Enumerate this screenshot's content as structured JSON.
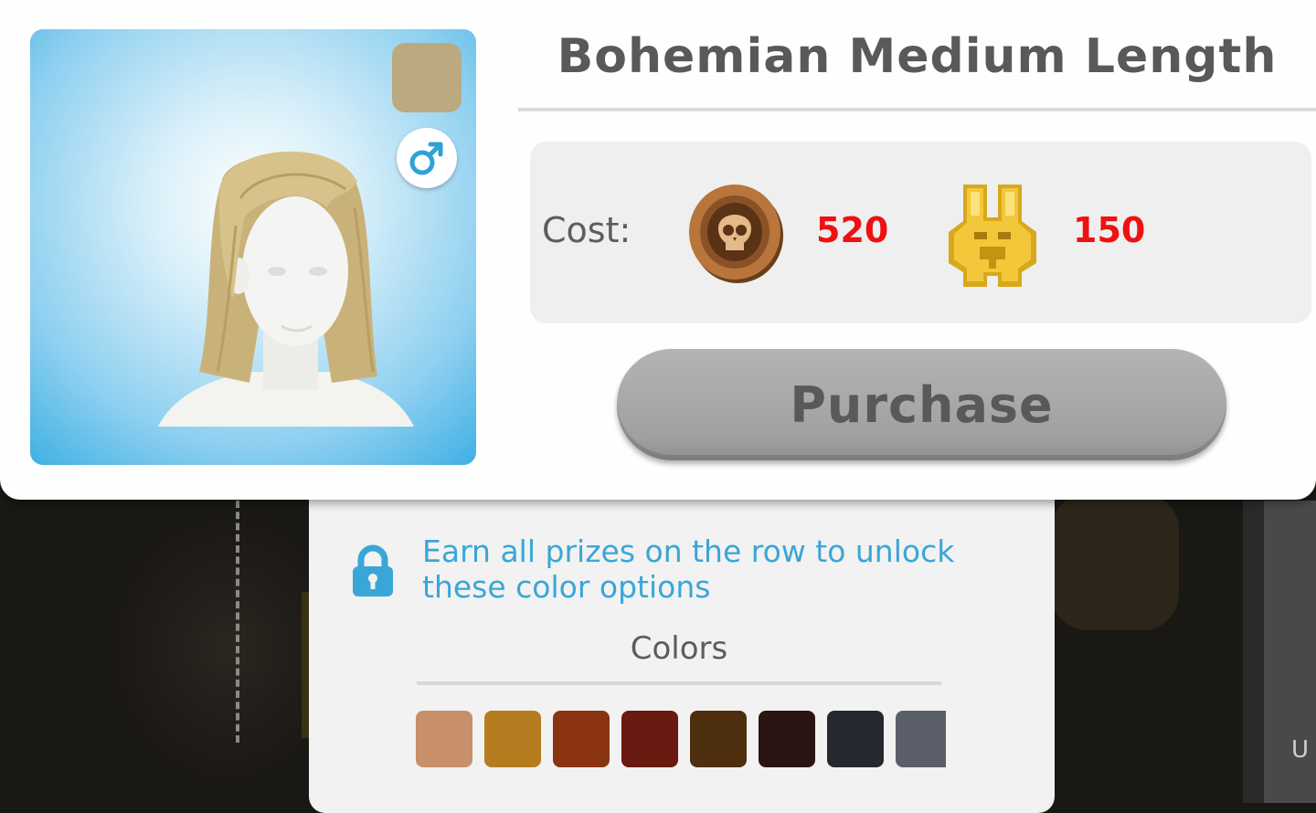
{
  "item": {
    "name": "Bohemian Medium Length",
    "selected_color": "#bba97f",
    "gender_icon": "male-symbol-icon"
  },
  "cost": {
    "label": "Cost:",
    "currencies": [
      {
        "icon": "skull-coin-icon",
        "amount": "520",
        "color": "#ee1111"
      },
      {
        "icon": "golden-token-icon",
        "amount": "150",
        "color": "#ee1111"
      }
    ]
  },
  "purchase": {
    "label": "Purchase",
    "enabled": false
  },
  "colors_panel": {
    "lock_icon": "padlock-icon",
    "unlock_message_line1": "Earn all prizes on the row to unlock",
    "unlock_message_line2": "these color options",
    "title": "Colors",
    "swatches": [
      "#c8906a",
      "#b47c1e",
      "#8b3411",
      "#6a1a10",
      "#4d2e0d",
      "#2a1512",
      "#25282e",
      "#5a5f6a"
    ]
  },
  "background": {
    "partial_text": "U"
  }
}
